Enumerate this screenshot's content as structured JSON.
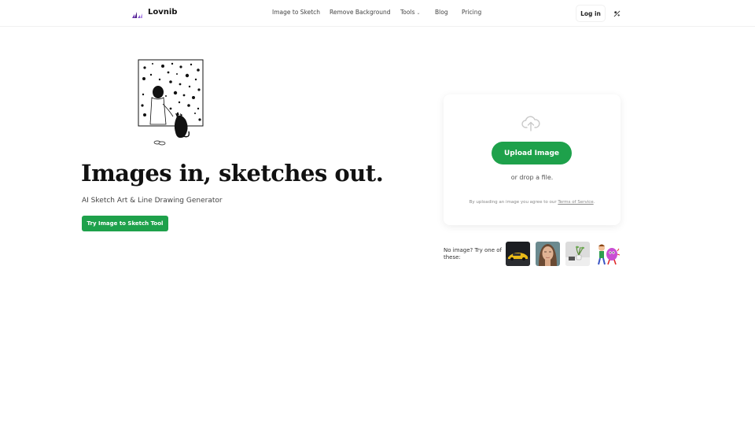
{
  "header": {
    "logo_text": "Lovnib",
    "nav": [
      {
        "label": "Image to Sketch"
      },
      {
        "label": "Remove Background"
      },
      {
        "label": "Tools"
      },
      {
        "label": "Blog"
      },
      {
        "label": "Pricing"
      }
    ],
    "login_label": "Log in",
    "theme_icon": "theme-toggle-icon"
  },
  "hero": {
    "title": "Images in, sketches out.",
    "subtitle": "AI Sketch Art & Line Drawing Generator",
    "cta_label": "Try Image to Sketch Tool",
    "illustration": "girl-and-cat-window-illustration"
  },
  "upload": {
    "icon": "cloud-upload-icon",
    "button_label": "Upload Image",
    "drop_text": "or drop a file.",
    "terms_prefix": "By uploading an image you agree to our",
    "terms_link": "Terms of Service",
    "terms_suffix": "."
  },
  "samples": {
    "label": "No image? Try one of these:",
    "images": [
      "sports-car",
      "woman-portrait",
      "plant-still-life",
      "cartoon-characters"
    ]
  },
  "colors": {
    "accent": "#1ea14b",
    "logo_purple": "#6b2fb3"
  }
}
